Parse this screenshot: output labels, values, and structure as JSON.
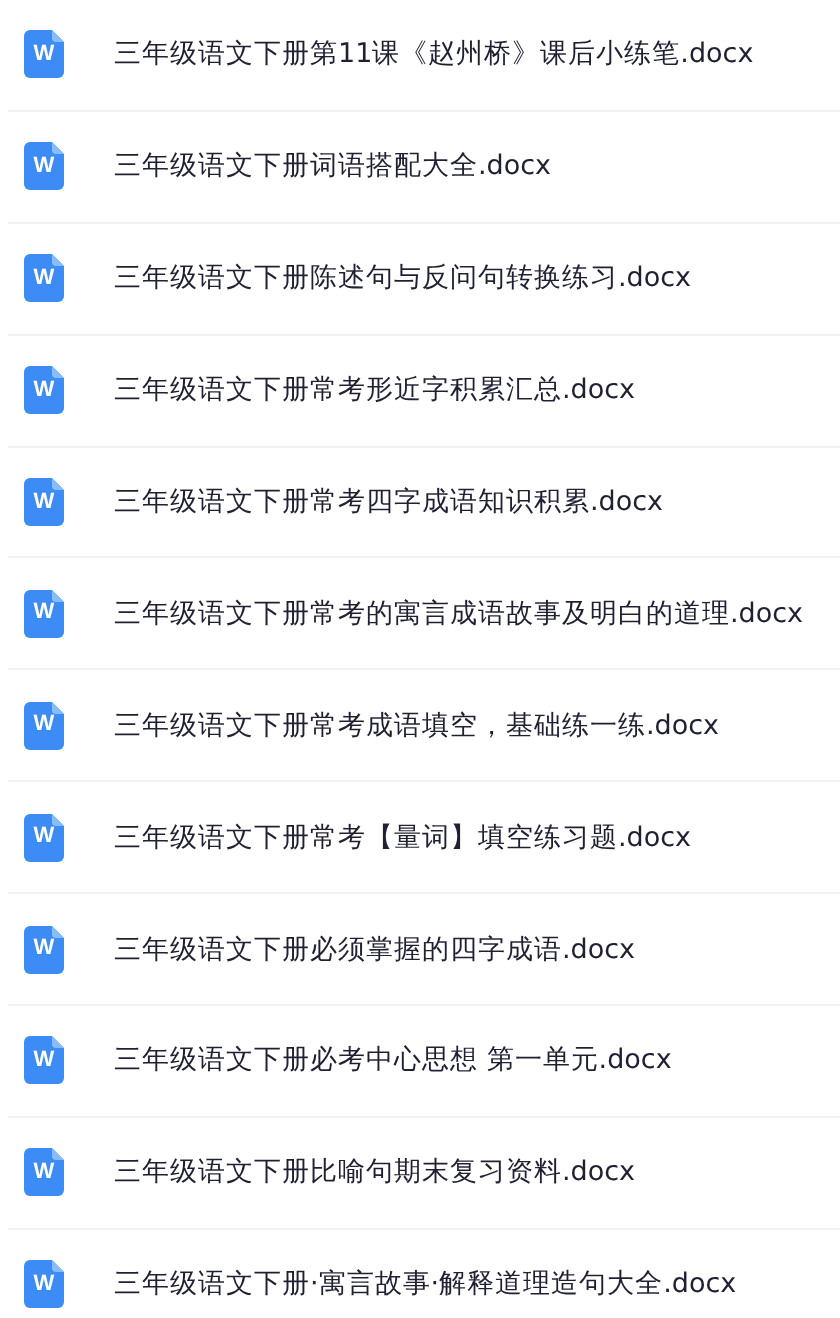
{
  "files": [
    {
      "icon_letter": "W",
      "name": "三年级语文下册第11课《赵州桥》课后小练笔.docx"
    },
    {
      "icon_letter": "W",
      "name": "三年级语文下册词语搭配大全.docx"
    },
    {
      "icon_letter": "W",
      "name": "三年级语文下册陈述句与反问句转换练习.docx"
    },
    {
      "icon_letter": "W",
      "name": "三年级语文下册常考形近字积累汇总.docx"
    },
    {
      "icon_letter": "W",
      "name": "三年级语文下册常考四字成语知识积累.docx"
    },
    {
      "icon_letter": "W",
      "name": "三年级语文下册常考的寓言成语故事及明白的道理.docx"
    },
    {
      "icon_letter": "W",
      "name": "三年级语文下册常考成语填空，基础练一练.docx"
    },
    {
      "icon_letter": "W",
      "name": "三年级语文下册常考【量词】填空练习题.docx"
    },
    {
      "icon_letter": "W",
      "name": "三年级语文下册必须掌握的四字成语.docx"
    },
    {
      "icon_letter": "W",
      "name": "三年级语文下册必考中心思想 第一单元.docx"
    },
    {
      "icon_letter": "W",
      "name": "三年级语文下册比喻句期末复习资料.docx"
    },
    {
      "icon_letter": "W",
      "name": "三年级语文下册·寓言故事·解释道理造句大全.docx"
    }
  ]
}
